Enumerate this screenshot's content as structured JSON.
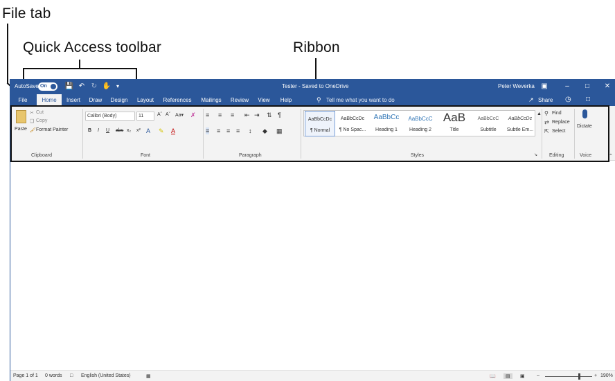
{
  "callouts": {
    "file_tab": "File tab",
    "quick_access": "Quick Access toolbar",
    "ribbon": "Ribbon"
  },
  "titlebar": {
    "autosave_label": "AutoSave",
    "autosave_state": "On",
    "title": "Tester - Saved to OneDrive",
    "user": "Peter Weverka"
  },
  "tabs": [
    "File",
    "Home",
    "Insert",
    "Draw",
    "Design",
    "Layout",
    "References",
    "Mailings",
    "Review",
    "View",
    "Help"
  ],
  "tell_me": "Tell me what you want to do",
  "share_label": "Share",
  "ribbon": {
    "clipboard": {
      "paste": "Paste",
      "cut": "Cut",
      "copy": "Copy",
      "format_painter": "Format Painter",
      "label": "Clipboard"
    },
    "font": {
      "family": "Calibri (Body)",
      "size": "11",
      "label": "Font"
    },
    "paragraph": {
      "label": "Paragraph"
    },
    "styles": {
      "items": [
        {
          "sample": "AaBbCcDc",
          "name": "¶ Normal"
        },
        {
          "sample": "AaBbCcDc",
          "name": "¶ No Spac..."
        },
        {
          "sample": "AaBbCc",
          "name": "Heading 1"
        },
        {
          "sample": "AaBbCcC",
          "name": "Heading 2"
        },
        {
          "sample": "AaB",
          "name": "Title"
        },
        {
          "sample": "AaBbCcC",
          "name": "Subtitle"
        },
        {
          "sample": "AaBbCcDc",
          "name": "Subtle Em..."
        }
      ],
      "label": "Styles"
    },
    "editing": {
      "find": "Find",
      "replace": "Replace",
      "select": "Select",
      "label": "Editing"
    },
    "voice": {
      "dictate": "Dictate",
      "label": "Voice"
    }
  },
  "status": {
    "page": "Page 1 of 1",
    "words": "0 words",
    "language": "English (United States)",
    "zoom": "190%"
  },
  "colors": {
    "accent": "#2b579a",
    "ribbon_bg": "#f3f3f3"
  }
}
